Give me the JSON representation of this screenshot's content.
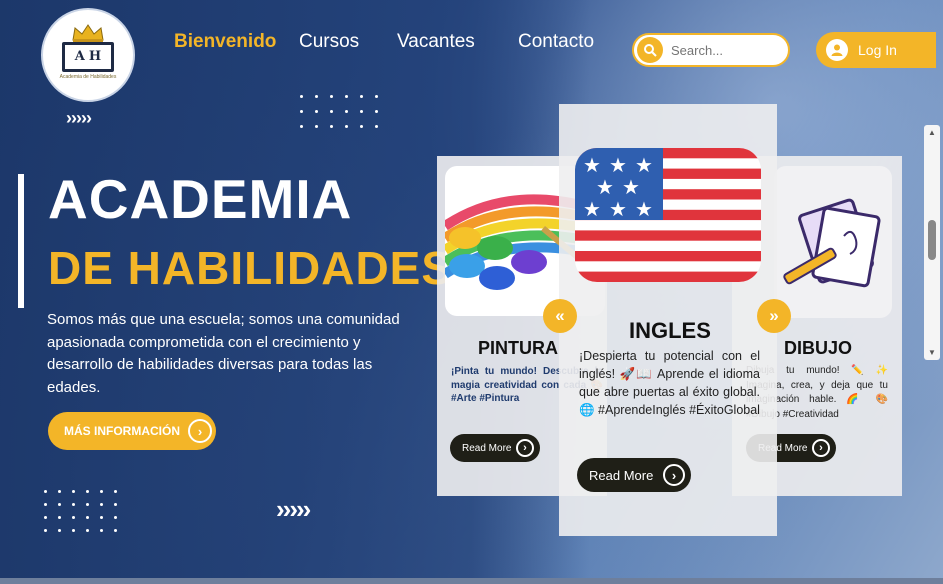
{
  "brand": {
    "logo_letters_left": "A",
    "logo_letters_right": "H",
    "logo_subtitle": "Academia de Habilidades"
  },
  "nav": {
    "items": [
      "Bienvenido",
      "Cursos",
      "Vacantes",
      "Contacto"
    ],
    "active": "Bienvenido"
  },
  "search": {
    "placeholder": "Search..."
  },
  "login": {
    "label": "Log In"
  },
  "hero": {
    "title_line1": "ACADEMIA",
    "title_line2": "DE HABILIDADES",
    "description": "Somos más que una escuela; somos una comunidad apasionada comprometida con el crecimiento y desarrollo de habilidades diversas para todas las edades.",
    "cta": "MÁS INFORMACIÓN"
  },
  "decor": {
    "chevrons": "›››››"
  },
  "cards": {
    "left": {
      "title": "PINTURA",
      "text": "¡Pinta tu mundo! Descubre la magia creatividad con cada 🎨 #Arte #Pintura",
      "button": "Read More"
    },
    "center": {
      "title": "INGLES",
      "text": "¡Despierta tu potencial con el inglés! 🚀📖 Aprende el idioma que abre puertas al éxito global. 🌐 #AprendeInglés #ÉxitoGlobal",
      "button": "Read More"
    },
    "right": {
      "title": "DIBUJO",
      "text": "Dibuja tu mundo! ✏️ ✨ Imagina, crea, y deja que tu imaginación hable. 🌈 🎨 #Dibujo #Creatividad",
      "button": "Read More"
    },
    "prev_arrow": "«",
    "next_arrow": "»"
  },
  "colors": {
    "accent": "#f3b528",
    "navy": "#1f3b6e",
    "button_dark": "#1f1f17"
  }
}
